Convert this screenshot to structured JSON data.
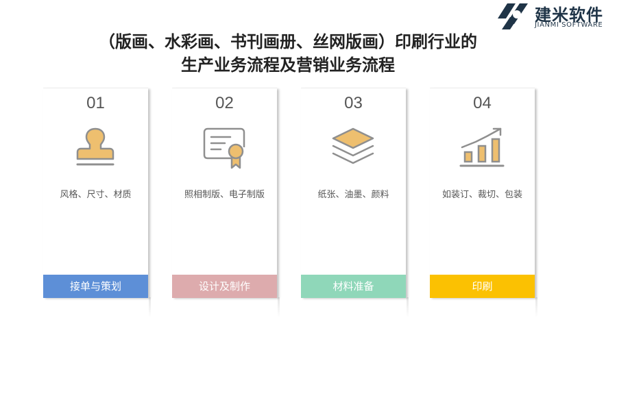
{
  "brand": {
    "name_cn": "建米软件",
    "name_en": "JIANMI SOFTWARE"
  },
  "title": {
    "line1": "（版画、水彩画、书刊画册、丝网版画）印刷行业的",
    "line2": "生产业务流程及营销业务流程"
  },
  "colors": {
    "icon_fill": "#eebf6f",
    "icon_stroke": "#8f8f8f",
    "step1": "#5d8fd7",
    "step2": "#ddabad",
    "step3": "#8fd7b9",
    "step4": "#fbc102"
  },
  "steps": [
    {
      "number": "01",
      "icon": "stamp-icon",
      "detail": "风格、尺寸、材质",
      "label": "接单与策划"
    },
    {
      "number": "02",
      "icon": "certificate-icon",
      "detail": "照相制版、电子制版",
      "label": "设计及制作"
    },
    {
      "number": "03",
      "icon": "layers-icon",
      "detail": "纸张、油墨、颜料",
      "label": "材料准备"
    },
    {
      "number": "04",
      "icon": "growth-chart-icon",
      "detail": "如装订、裁切、包装",
      "label": "印刷"
    }
  ]
}
